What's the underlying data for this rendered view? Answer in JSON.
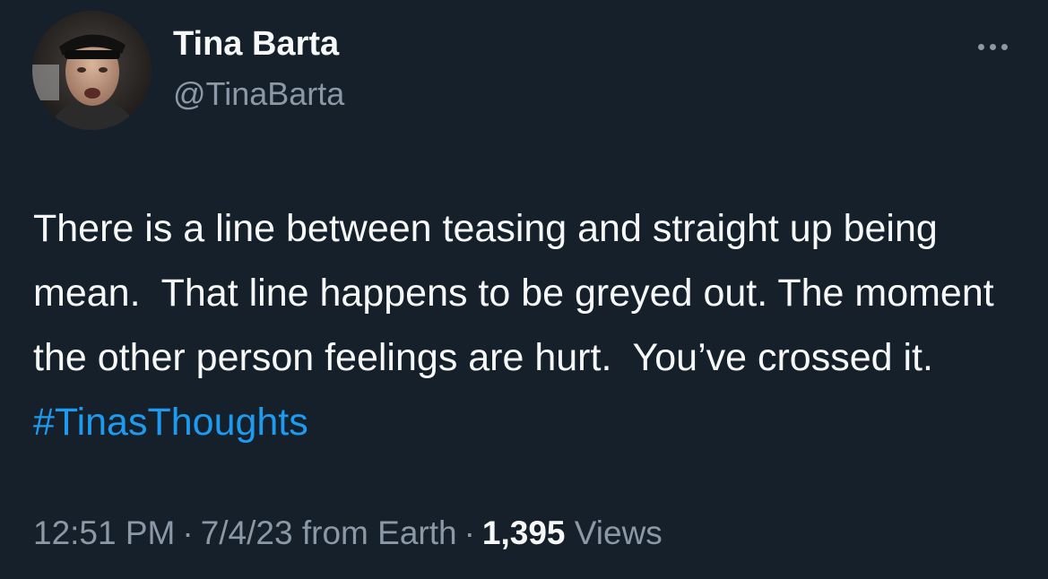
{
  "author": {
    "name": "Tina Barta",
    "handle": "@TinaBarta"
  },
  "tweet": {
    "text_before_hashtag": "There is a line between teasing and straight up being mean.  That line happens to be greyed out. The moment the other person feelings are hurt.  You’ve crossed it.  ",
    "hashtag": "#TinasThoughts"
  },
  "meta": {
    "time": "12:51 PM",
    "separator": "·",
    "date": "7/4/23",
    "source": "from Earth",
    "views_count": "1,395",
    "views_label": "Views"
  },
  "icons": {
    "more": "more-horizontal-icon"
  },
  "colors": {
    "background": "#15202b",
    "primary_text": "#f7f9f9",
    "secondary_text": "#8b98a5",
    "link": "#1d9bf0"
  }
}
